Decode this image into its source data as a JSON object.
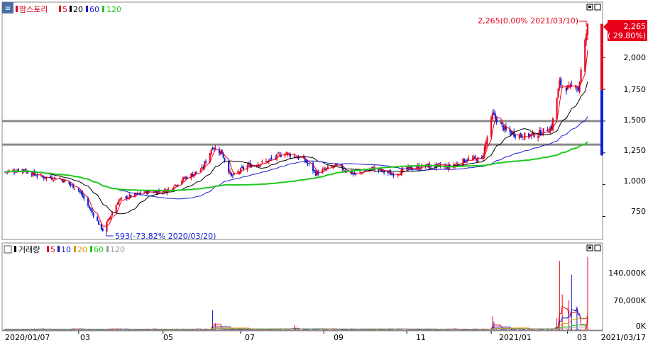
{
  "colors": {
    "up": "#e8001b",
    "down": "#1020d8",
    "ma5": "#e8001b",
    "ma20": "#000000",
    "ma60": "#1a1acc",
    "ma120": "#1ec81e",
    "vol_ma20": "#e09a00",
    "vol_ma120": "#9a9a9a",
    "support_line": "#8a8a8a",
    "badge_bg": "#e8001b"
  },
  "price_panel": {
    "icon": "menu-icon",
    "title": "팜스토리",
    "legend": [
      {
        "label": "5",
        "color": "#e8001b"
      },
      {
        "label": "20",
        "color": "#000000"
      },
      {
        "label": "60",
        "color": "#1a1acc"
      },
      {
        "label": "120",
        "color": "#1ec81e"
      }
    ],
    "y_ticks": [
      "2,000",
      "1,750",
      "1,500",
      "1,250",
      "1,000",
      "750"
    ],
    "last_price_badge": {
      "price": "2,265",
      "change": "( 29.80%)"
    },
    "high_annotation": "2,265(0.00% 2021/03/10)",
    "low_annotation": "593(-73.82% 2020/03/20)"
  },
  "volume_panel": {
    "title": "거래량",
    "legend": [
      {
        "label": "5",
        "color": "#e8001b"
      },
      {
        "label": "10",
        "color": "#1a1acc"
      },
      {
        "label": "20",
        "color": "#e09a00"
      },
      {
        "label": "60",
        "color": "#1ec81e"
      },
      {
        "label": "120",
        "color": "#9a9a9a"
      }
    ],
    "y_ticks": [
      "140,000K",
      "70,000K",
      "0K"
    ]
  },
  "x_axis": {
    "labels": [
      "2020/01/07",
      "03",
      "05",
      "07",
      "09",
      "11",
      "2021/01",
      "03",
      "2021/03/17"
    ]
  },
  "chart_data": {
    "type": "candlestick",
    "title": "팜스토리",
    "x_range": [
      "2020/01/07",
      "2021/03/17"
    ],
    "price_ylim": [
      580,
      2330
    ],
    "volume_ylim_k": [
      0,
      190000
    ],
    "support_levels": [
      1500,
      1315
    ],
    "moving_averages": [
      "5",
      "20",
      "60",
      "120"
    ],
    "anchors": [
      {
        "date": "2020/01/07",
        "close": 1100
      },
      {
        "date": "2020/01/20",
        "close": 1120
      },
      {
        "date": "2020/02/03",
        "close": 1060
      },
      {
        "date": "2020/02/17",
        "close": 1050
      },
      {
        "date": "2020/03/02",
        "close": 960
      },
      {
        "date": "2020/03/12",
        "close": 780
      },
      {
        "date": "2020/03/20",
        "close": 640
      },
      {
        "date": "2020/04/01",
        "close": 880
      },
      {
        "date": "2020/04/20",
        "close": 940
      },
      {
        "date": "2020/05/06",
        "close": 950
      },
      {
        "date": "2020/05/20",
        "close": 1050
      },
      {
        "date": "2020/06/02",
        "close": 1120
      },
      {
        "date": "2020/06/10",
        "close": 1300
      },
      {
        "date": "2020/06/17",
        "close": 1250
      },
      {
        "date": "2020/06/24",
        "close": 1060
      },
      {
        "date": "2020/07/06",
        "close": 1150
      },
      {
        "date": "2020/07/20",
        "close": 1180
      },
      {
        "date": "2020/08/03",
        "close": 1250
      },
      {
        "date": "2020/08/17",
        "close": 1200
      },
      {
        "date": "2020/08/26",
        "close": 1090
      },
      {
        "date": "2020/09/10",
        "close": 1150
      },
      {
        "date": "2020/09/24",
        "close": 1080
      },
      {
        "date": "2020/10/08",
        "close": 1130
      },
      {
        "date": "2020/10/22",
        "close": 1080
      },
      {
        "date": "2020/11/05",
        "close": 1130
      },
      {
        "date": "2020/11/19",
        "close": 1150
      },
      {
        "date": "2020/12/03",
        "close": 1140
      },
      {
        "date": "2020/12/17",
        "close": 1200
      },
      {
        "date": "2020/12/28",
        "close": 1200
      },
      {
        "date": "2021/01/05",
        "close": 1550
      },
      {
        "date": "2021/01/15",
        "close": 1420
      },
      {
        "date": "2021/01/28",
        "close": 1380
      },
      {
        "date": "2021/02/08",
        "close": 1400
      },
      {
        "date": "2021/02/18",
        "close": 1450
      },
      {
        "date": "2021/02/24",
        "close": 1800
      },
      {
        "date": "2021/03/03",
        "close": 1750
      },
      {
        "date": "2021/03/08",
        "close": 1800
      },
      {
        "date": "2021/03/10",
        "close": 1745
      },
      {
        "date": "2021/03/17",
        "close": 2265
      }
    ],
    "volume_spikes_k": [
      {
        "date": "2020/06/10",
        "volume": 50000
      },
      {
        "date": "2020/06/12",
        "volume": 18000
      },
      {
        "date": "2020/08/10",
        "volume": 12000
      },
      {
        "date": "2021/01/05",
        "volume": 35000
      },
      {
        "date": "2021/01/06",
        "volume": 22000
      },
      {
        "date": "2021/02/22",
        "volume": 30000
      },
      {
        "date": "2021/02/24",
        "volume": 175000
      },
      {
        "date": "2021/02/26",
        "volume": 90000
      },
      {
        "date": "2021/03/03",
        "volume": 75000
      },
      {
        "date": "2021/03/05",
        "volume": 140000
      },
      {
        "date": "2021/03/09",
        "volume": 60000
      },
      {
        "date": "2021/03/17",
        "volume": 185000
      }
    ]
  }
}
